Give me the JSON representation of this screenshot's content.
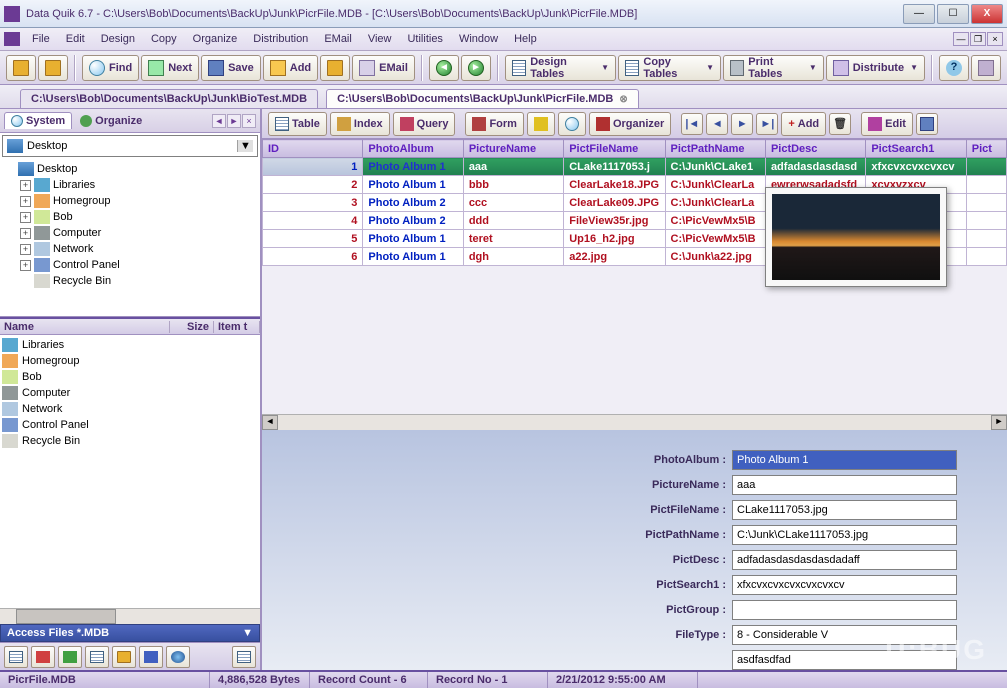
{
  "window": {
    "title": "Data Quik 6.7 - C:\\Users\\Bob\\Documents\\BackUp\\Junk\\PicrFile.MDB - [C:\\Users\\Bob\\Documents\\BackUp\\Junk\\PicrFile.MDB]"
  },
  "menu": [
    "File",
    "Edit",
    "Design",
    "Copy",
    "Organize",
    "Distribution",
    "EMail",
    "View",
    "Utilities",
    "Window",
    "Help"
  ],
  "toolbar": {
    "find": "Find",
    "next": "Next",
    "save": "Save",
    "add": "Add",
    "email": "EMail",
    "design_tables": "Design Tables",
    "copy_tables": "Copy Tables",
    "print_tables": "Print Tables",
    "distribute": "Distribute",
    "help": "?"
  },
  "tabs": {
    "t1": "C:\\Users\\Bob\\Documents\\BackUp\\Junk\\BioTest.MDB",
    "t2": "C:\\Users\\Bob\\Documents\\BackUp\\Junk\\PicrFile.MDB"
  },
  "left": {
    "system": "System",
    "organize": "Organize",
    "desktop": "Desktop",
    "tree": [
      {
        "label": "Desktop",
        "icon": "ni-desk",
        "exp": "none",
        "indent": 0
      },
      {
        "label": "Libraries",
        "icon": "ni-lib",
        "exp": "+",
        "indent": 1
      },
      {
        "label": "Homegroup",
        "icon": "ni-home",
        "exp": "+",
        "indent": 1
      },
      {
        "label": "Bob",
        "icon": "ni-user",
        "exp": "+",
        "indent": 1
      },
      {
        "label": "Computer",
        "icon": "ni-comp",
        "exp": "+",
        "indent": 1
      },
      {
        "label": "Network",
        "icon": "ni-net",
        "exp": "+",
        "indent": 1
      },
      {
        "label": "Control Panel",
        "icon": "ni-cpl",
        "exp": "+",
        "indent": 1
      },
      {
        "label": "Recycle Bin",
        "icon": "ni-bin",
        "exp": "none",
        "indent": 1
      }
    ],
    "cols": {
      "name": "Name",
      "size": "Size",
      "item": "Item t"
    },
    "files": [
      {
        "label": "Libraries",
        "icon": "ni-lib"
      },
      {
        "label": "Homegroup",
        "icon": "ni-home"
      },
      {
        "label": "Bob",
        "icon": "ni-user"
      },
      {
        "label": "Computer",
        "icon": "ni-comp"
      },
      {
        "label": "Network",
        "icon": "ni-net"
      },
      {
        "label": "Control Panel",
        "icon": "ni-cpl"
      },
      {
        "label": "Recycle Bin",
        "icon": "ni-bin"
      }
    ],
    "access": "Access Files *.MDB"
  },
  "rtoolbar": {
    "table": "Table",
    "index": "Index",
    "query": "Query",
    "form": "Form",
    "organizer": "Organizer",
    "add": "Add",
    "edit": "Edit"
  },
  "grid": {
    "headers": [
      "ID",
      "PhotoAlbum",
      "PictureName",
      "PictFileName",
      "PictPathName",
      "PictDesc",
      "PictSearch1",
      "Pict"
    ],
    "rows": [
      {
        "id": "1",
        "album": "Photo Album 1",
        "name": "aaa",
        "file": "CLake1117053.j",
        "path": "C:\\Junk\\CLake1",
        "desc": "adfadasdasdasd",
        "search": "xfxcvxcvxcvxcv"
      },
      {
        "id": "2",
        "album": "Photo Album 1",
        "name": "bbb",
        "file": "ClearLake18.JPG",
        "path": "C:\\Junk\\ClearLa",
        "desc": "ewrerwsadadsfd",
        "search": "xcvxvzxcv"
      },
      {
        "id": "3",
        "album": "Photo Album 2",
        "name": "ccc",
        "file": "ClearLake09.JPG",
        "path": "C:\\Junk\\ClearLa",
        "desc": "",
        "search": ""
      },
      {
        "id": "4",
        "album": "Photo Album 2",
        "name": "ddd",
        "file": "FileView35r.jpg",
        "path": "C:\\PicVewMx5\\B",
        "desc": "",
        "search": ""
      },
      {
        "id": "5",
        "album": "Photo Album 1",
        "name": "teret",
        "file": "Up16_h2.jpg",
        "path": "C:\\PicVewMx5\\B",
        "desc": "",
        "search": ""
      },
      {
        "id": "6",
        "album": "Photo Album 1",
        "name": "dgh",
        "file": "a22.jpg",
        "path": "C:\\Junk\\a22.jpg",
        "desc": "",
        "search": ""
      }
    ]
  },
  "form": {
    "PhotoAlbum": {
      "label": "PhotoAlbum :",
      "value": "Photo Album 1"
    },
    "PictureName": {
      "label": "PictureName :",
      "value": "aaa"
    },
    "PictFileName": {
      "label": "PictFileName :",
      "value": "CLake1117053.jpg"
    },
    "PictPathName": {
      "label": "PictPathName :",
      "value": "C:\\Junk\\CLake1117053.jpg"
    },
    "PictDesc": {
      "label": "PictDesc :",
      "value": "adfadasdasdasdasdadaff"
    },
    "PictSearch1": {
      "label": "PictSearch1 :",
      "value": "xfxcvxcvxcvxcvxcvxcv"
    },
    "PictGroup": {
      "label": "PictGroup :",
      "value": ""
    },
    "FileType": {
      "label": "FileType :",
      "value": "8 - Considerable V"
    },
    "extra": "asdfasdfad"
  },
  "status": {
    "file": "PicrFile.MDB",
    "bytes": "4,886,528 Bytes",
    "count": "Record Count - 6",
    "recno": "Record No - 1",
    "date": "2/21/2012 9:55:00 AM"
  },
  "watermark": "U:BUG"
}
